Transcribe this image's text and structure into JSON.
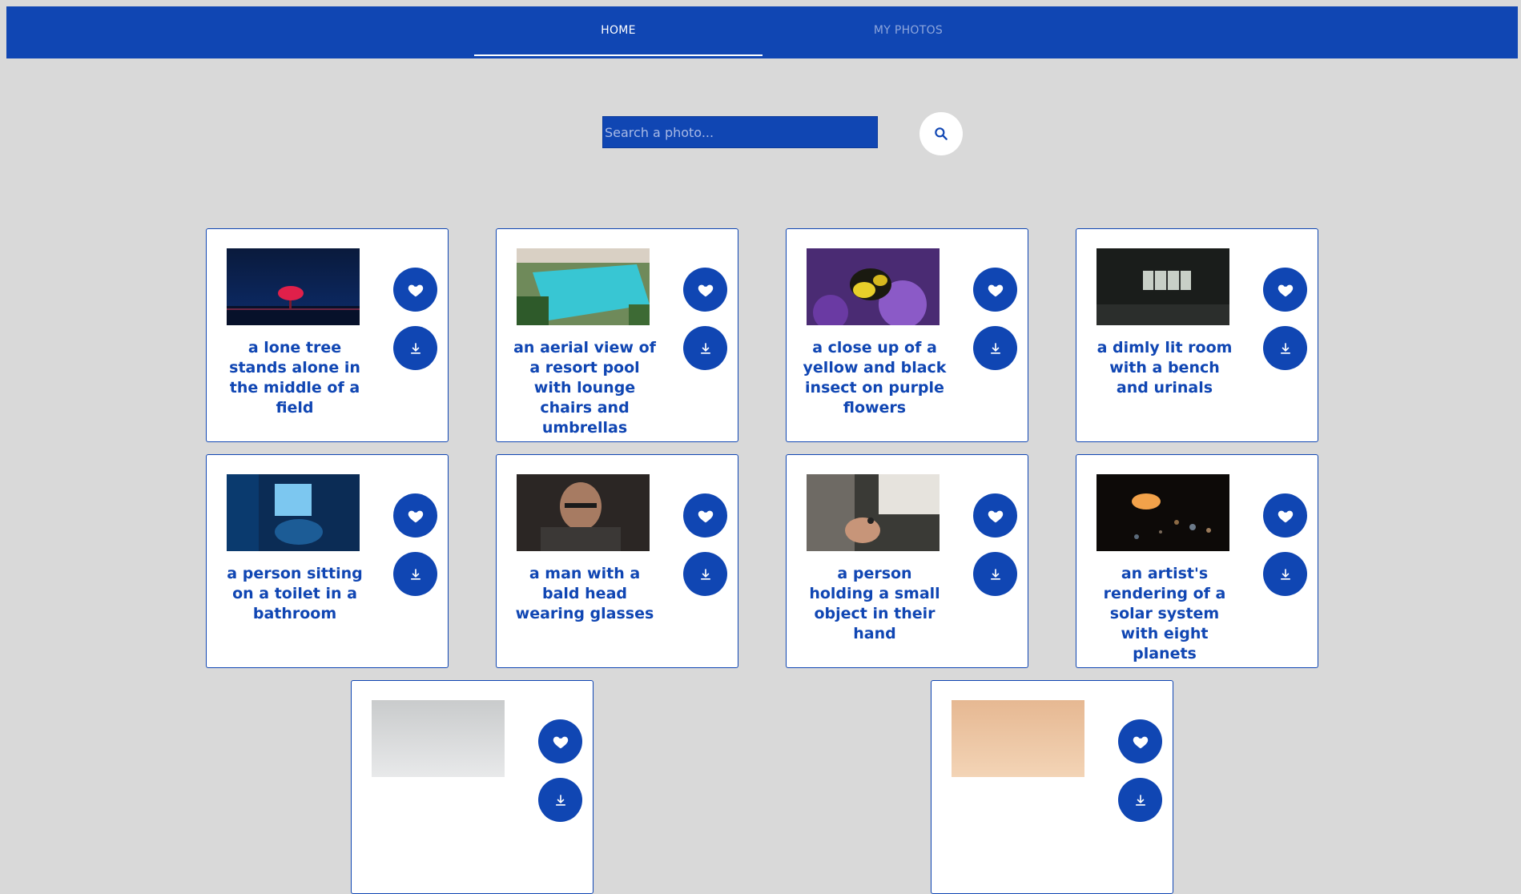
{
  "nav": {
    "tabs": [
      {
        "label": "HOME",
        "active": true
      },
      {
        "label": "MY PHOTOS",
        "active": false
      }
    ]
  },
  "search": {
    "placeholder": "Search a photo...",
    "value": "",
    "button_icon": "search-icon"
  },
  "colors": {
    "primary": "#1046b3",
    "background": "#d9d9d9",
    "card": "#ffffff"
  },
  "photos": [
    {
      "caption": "a lone tree stands alone in the middle of a field",
      "scene": "tree"
    },
    {
      "caption": "an aerial view of a resort pool with lounge chairs and umbrellas",
      "scene": "pool"
    },
    {
      "caption": "a close up of a yellow and black insect on purple flowers",
      "scene": "insect"
    },
    {
      "caption": "a dimly lit room with a bench and urinals",
      "scene": "room"
    },
    {
      "caption": "a person sitting on a toilet in a bathroom",
      "scene": "bathroom"
    },
    {
      "caption": "a man with a bald head wearing glasses",
      "scene": "man"
    },
    {
      "caption": "a person holding a small object in their hand",
      "scene": "hand"
    },
    {
      "caption": "an artist's rendering of a solar system with eight planets",
      "scene": "planets"
    },
    {
      "caption": "",
      "scene": "fog"
    },
    {
      "caption": "",
      "scene": "sunset"
    }
  ],
  "card_actions": {
    "favorite_icon": "heart-icon",
    "download_icon": "download-icon"
  }
}
